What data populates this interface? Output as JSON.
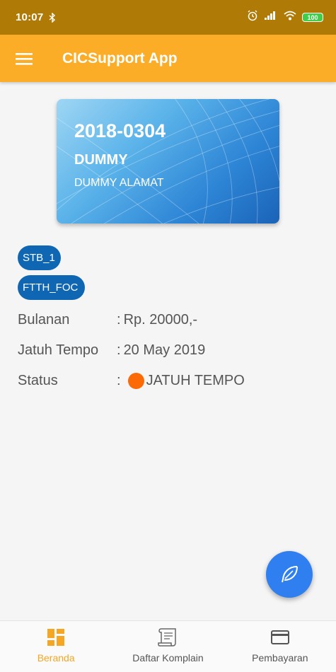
{
  "status_bar": {
    "time": "10:07",
    "battery": "100"
  },
  "app_bar": {
    "title": "CICSupport App"
  },
  "card": {
    "id": "2018-0304",
    "name": "DUMMY",
    "address": "DUMMY ALAMAT"
  },
  "services": [
    {
      "label": "STB_1"
    },
    {
      "label": "FTTH_FOC"
    }
  ],
  "info": {
    "rows": [
      {
        "label": "Bulanan",
        "colon": ":",
        "value": "Rp. 20000,-"
      },
      {
        "label": "Jatuh Tempo",
        "colon": ":",
        "value": "20 May 2019"
      },
      {
        "label": "Status",
        "colon": ":",
        "value": "JATUH TEMPO"
      }
    ],
    "status_color": "#fb6a05"
  },
  "bottom_nav": {
    "items": [
      {
        "label": "Beranda",
        "icon": "dashboard-icon",
        "active": true
      },
      {
        "label": "Daftar Komplain",
        "icon": "scroll-icon",
        "active": false
      },
      {
        "label": "Pembayaran",
        "icon": "credit-card-icon",
        "active": false
      }
    ]
  },
  "colors": {
    "status_bar": "#b07a07",
    "app_bar": "#fbad27",
    "chip": "#0f67b3",
    "fab": "#2f7ff0",
    "active_nav": "#f5a623"
  }
}
